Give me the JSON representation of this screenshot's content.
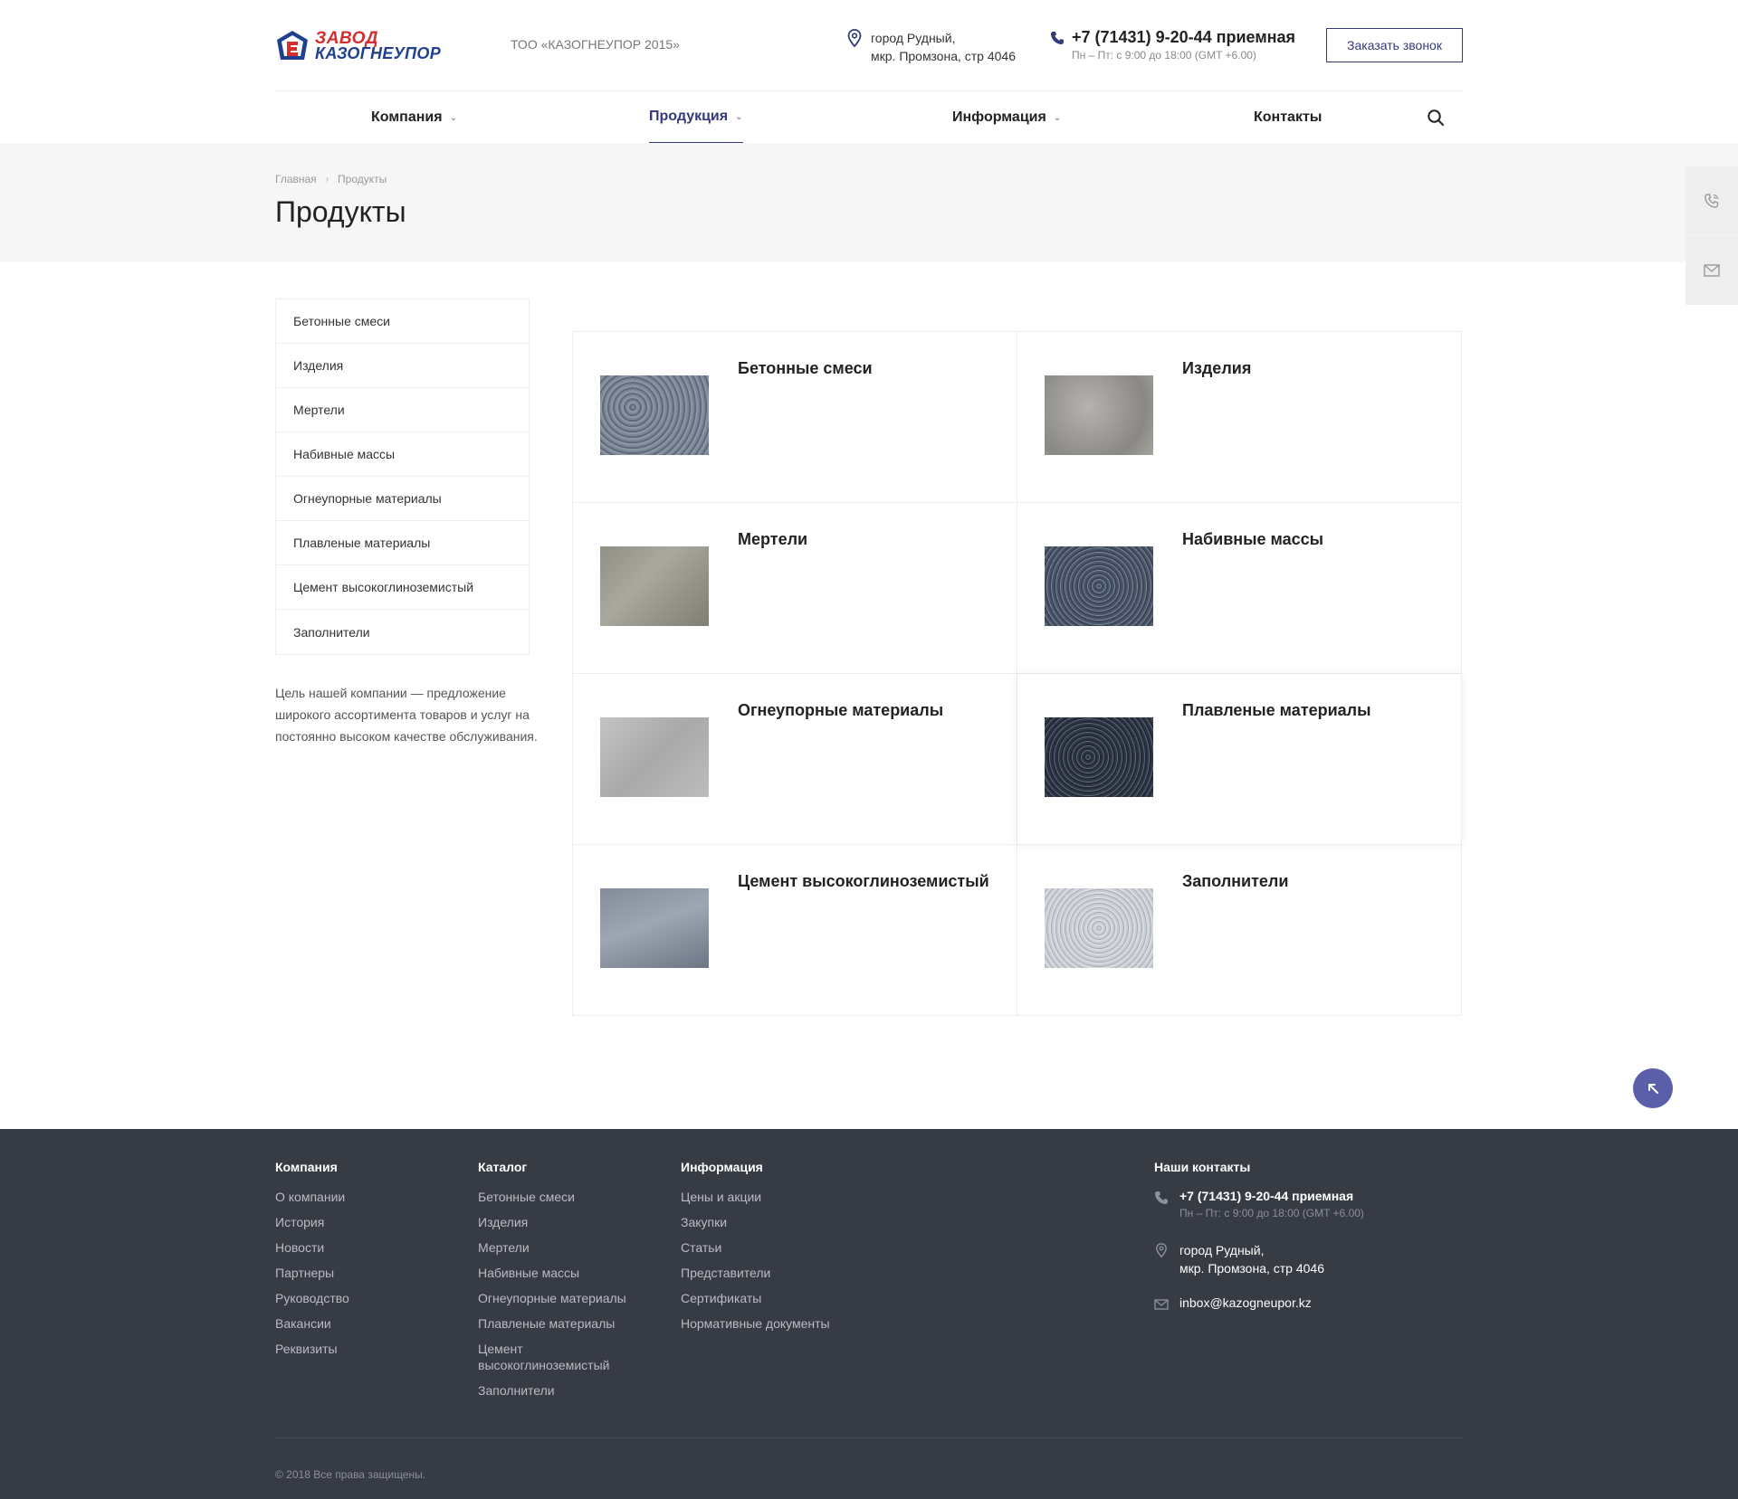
{
  "header": {
    "logo": {
      "line1": "ЗАВОД",
      "line2": "КАЗОГНЕУПОР",
      "icon": "logo-icon"
    },
    "company_name": "ТОО «КАЗОГНЕУПОР 2015»",
    "address_line1": "город Рудный,",
    "address_line2": "мкр. Промзона, стр 4046",
    "phone": "+7 (71431) 9-20-44 приемная",
    "hours": "Пн – Пт: с 9:00 до 18:00 (GMT +6.00)",
    "callback_label": "Заказать звонок"
  },
  "nav": {
    "items": [
      {
        "label": "Компания",
        "dropdown": true
      },
      {
        "label": "Продукция",
        "dropdown": true,
        "active": true
      },
      {
        "label": "Информация",
        "dropdown": true
      },
      {
        "label": "Контакты",
        "dropdown": false
      }
    ]
  },
  "breadcrumb": {
    "home": "Главная",
    "sep": "›",
    "current": "Продукты"
  },
  "page_title": "Продукты",
  "sidebar": {
    "items": [
      "Бетонные смеси",
      "Изделия",
      "Мертели",
      "Набивные массы",
      "Огнеупорные материалы",
      "Плавленые материалы",
      "Цемент высокоглиноземистый",
      "Заполнители"
    ],
    "text": "Цель нашей компании — предложение широкого ассортимента товаров и услуг на постоянно высоком качестве обслуживания."
  },
  "products": [
    {
      "title": "Бетонные смеси"
    },
    {
      "title": "Изделия"
    },
    {
      "title": "Мертели"
    },
    {
      "title": "Набивные массы"
    },
    {
      "title": "Огнеупорные материалы"
    },
    {
      "title": "Плавленые материалы"
    },
    {
      "title": "Цемент высокоглиноземистый"
    },
    {
      "title": "Заполнители"
    }
  ],
  "footer": {
    "company": {
      "heading": "Компания",
      "links": [
        "О компании",
        "История",
        "Новости",
        "Партнеры",
        "Руководство",
        "Вакансии",
        "Реквизиты"
      ]
    },
    "catalog": {
      "heading": "Каталог",
      "links": [
        "Бетонные смеси",
        "Изделия",
        "Мертели",
        "Набивные массы",
        "Огнеупорные материалы",
        "Плавленые материалы",
        "Цемент высокоглиноземистый",
        "Заполнители"
      ]
    },
    "info": {
      "heading": "Информация",
      "links": [
        "Цены и акции",
        "Закупки",
        "Статьи",
        "Представители",
        "Сертификаты",
        "Нормативные документы"
      ]
    },
    "contacts": {
      "heading": "Наши контакты",
      "phone": "+7 (71431) 9-20-44 приемная",
      "hours": "Пн – Пт: с 9:00 до 18:00 (GMT +6.00)",
      "address_line1": "город Рудный,",
      "address_line2": "мкр. Промзона, стр 4046",
      "email": "inbox@kazogneupor.kz"
    },
    "copyright": "© 2018 Все права защищены."
  },
  "colors": {
    "accent": "#353a7a",
    "footer_bg": "#373b44",
    "scroll_button": "#5b5ea9",
    "logo_red": "#d32f2f",
    "logo_blue": "#1f3f8f"
  }
}
